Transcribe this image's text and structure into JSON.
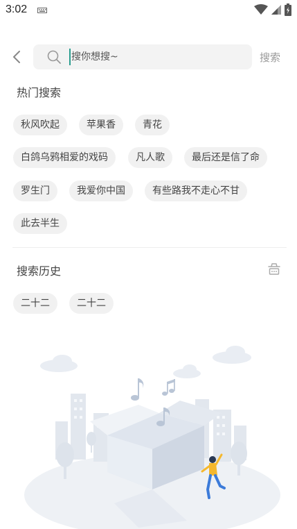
{
  "status": {
    "time": "3:02"
  },
  "search": {
    "placeholder": "搜你想搜~",
    "button_label": "搜索"
  },
  "hot": {
    "title": "热门搜索",
    "tags": [
      "秋风吹起",
      "苹果香",
      "青花",
      "白鸽乌鸦相爱的戏码",
      "凡人歌",
      "最后还是信了命",
      "罗生门",
      "我爱你中国",
      "有些路我不走心不甘",
      "此去半生"
    ]
  },
  "history": {
    "title": "搜索历史",
    "tags": [
      "二十二",
      "二十二"
    ]
  },
  "icons": [
    "back-arrow-icon",
    "search-icon",
    "trash-icon",
    "wifi-icon",
    "signal-icon",
    "battery-icon",
    "keyboard-icon"
  ],
  "colors": {
    "cursor": "#2a9d8f",
    "tag_bg": "#f1f1f1",
    "search_bg": "#f3f3f3"
  }
}
